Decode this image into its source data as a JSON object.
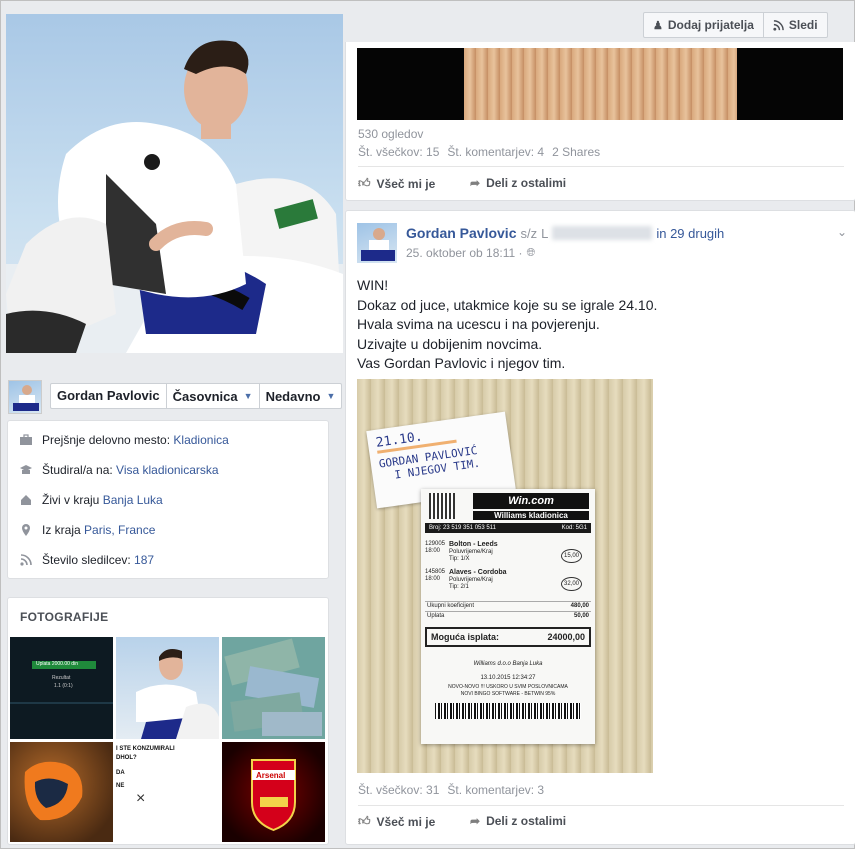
{
  "header": {
    "add_friend_label": "Dodaj prijatelja",
    "follow_label": "Sledi"
  },
  "profile_bar": {
    "name": "Gordan Pavlovic",
    "timeline_label": "Časovnica",
    "recent_label": "Nedavno"
  },
  "intro": {
    "items": [
      {
        "icon": "briefcase-icon",
        "prefix": "Prejšnje delovno mesto: ",
        "value": "Kladionica"
      },
      {
        "icon": "education-icon",
        "prefix": "Študiral/a na: ",
        "value": "Visa kladionicarska"
      },
      {
        "icon": "home-icon",
        "prefix": "Živi v kraju ",
        "value": "Banja Luka"
      },
      {
        "icon": "location-pin-icon",
        "prefix": "Iz kraja ",
        "value": "Paris, France"
      },
      {
        "icon": "rss-icon",
        "prefix": "Število sledilcev: ",
        "value": "187"
      }
    ]
  },
  "photos": {
    "title": "FOTOGRAFIJE",
    "tile1_text_top": "Uplata  2000.00 din",
    "tile1_text_mid": "Rezultat",
    "tile1_text_bot": "1.1  (0:1)",
    "tile5_line1": "I STE KONZUMIRALI",
    "tile5_line2": "DHOL?",
    "tile5_line3": "DA",
    "tile5_line4": "NE",
    "tile6_text": "Arsenal"
  },
  "post1": {
    "views": "530 ogledov",
    "stats_all": "Št. všečkov: 15",
    "stats_comments": "Št. komentarjev: 4",
    "shares": "2 Shares",
    "like_label": "Všeč mi je",
    "share_label": "Deli z ostalimi"
  },
  "post2": {
    "author": "Gordan Pavlovic",
    "with_prefix": "s/z",
    "tagged_initial": "L",
    "others": "in 29 drugih",
    "timestamp": "25. oktober ob 18:11 ·",
    "lines": [
      "WIN!",
      "Dokaz od juce, utakmice koje su se igrale 24.10.",
      "Hvala svima na ucescu i na povjerenju.",
      "Uzivajte u dobijenim novcima.",
      "Vas Gordan Pavlovic i njegov tim."
    ],
    "note_lines": [
      "21.10.",
      "GORDAN PAVLOVIĆ",
      "I NJEGOV TIM."
    ],
    "ticket": {
      "brand": "Win.com",
      "brand_sub": "Williams kladionica",
      "number": "Broj: 23 519 351 053 511",
      "code": "Kod: 5G1",
      "match1_id": "129005",
      "match1_time": "18:00",
      "match1": "Bolton - Leeds",
      "match1_bet": "Poluvrijeme/Kraj",
      "match1_tip": "Tip: 1/X",
      "match1_odd": "15,00",
      "match2_id": "145805",
      "match2_time": "18:00",
      "match2": "Alaves - Cordoba",
      "match2_bet": "Poluvrijeme/Kraj",
      "match2_tip": "Tip: 2/1",
      "match2_odd": "32,00",
      "coef_label": "Ukupni koeficijent",
      "coef_value": "480,00",
      "stake_label": "Uplata",
      "stake_value": "50,00",
      "payout_label": "Moguća isplata:",
      "payout_value": "24000,00",
      "footer1": "Williams d.o.o  Banja Luka",
      "footer2": "13.10.2015     12:34:27",
      "footer3": "NOVO-NOVO !!! USKORO U SVIM POSLOVNICAMA",
      "footer4": "NOVI BINGO SOFTWARE - BETWIN 95%"
    },
    "stats_all": "Št. všečkov: 31",
    "stats_comments": "Št. komentarjev: 3",
    "like_label": "Všeč mi je",
    "share_label": "Deli z ostalimi"
  },
  "colors": {
    "link": "#365899",
    "muted": "#90949c",
    "border": "#dddfe2",
    "page_bg": "#e9ebee"
  }
}
